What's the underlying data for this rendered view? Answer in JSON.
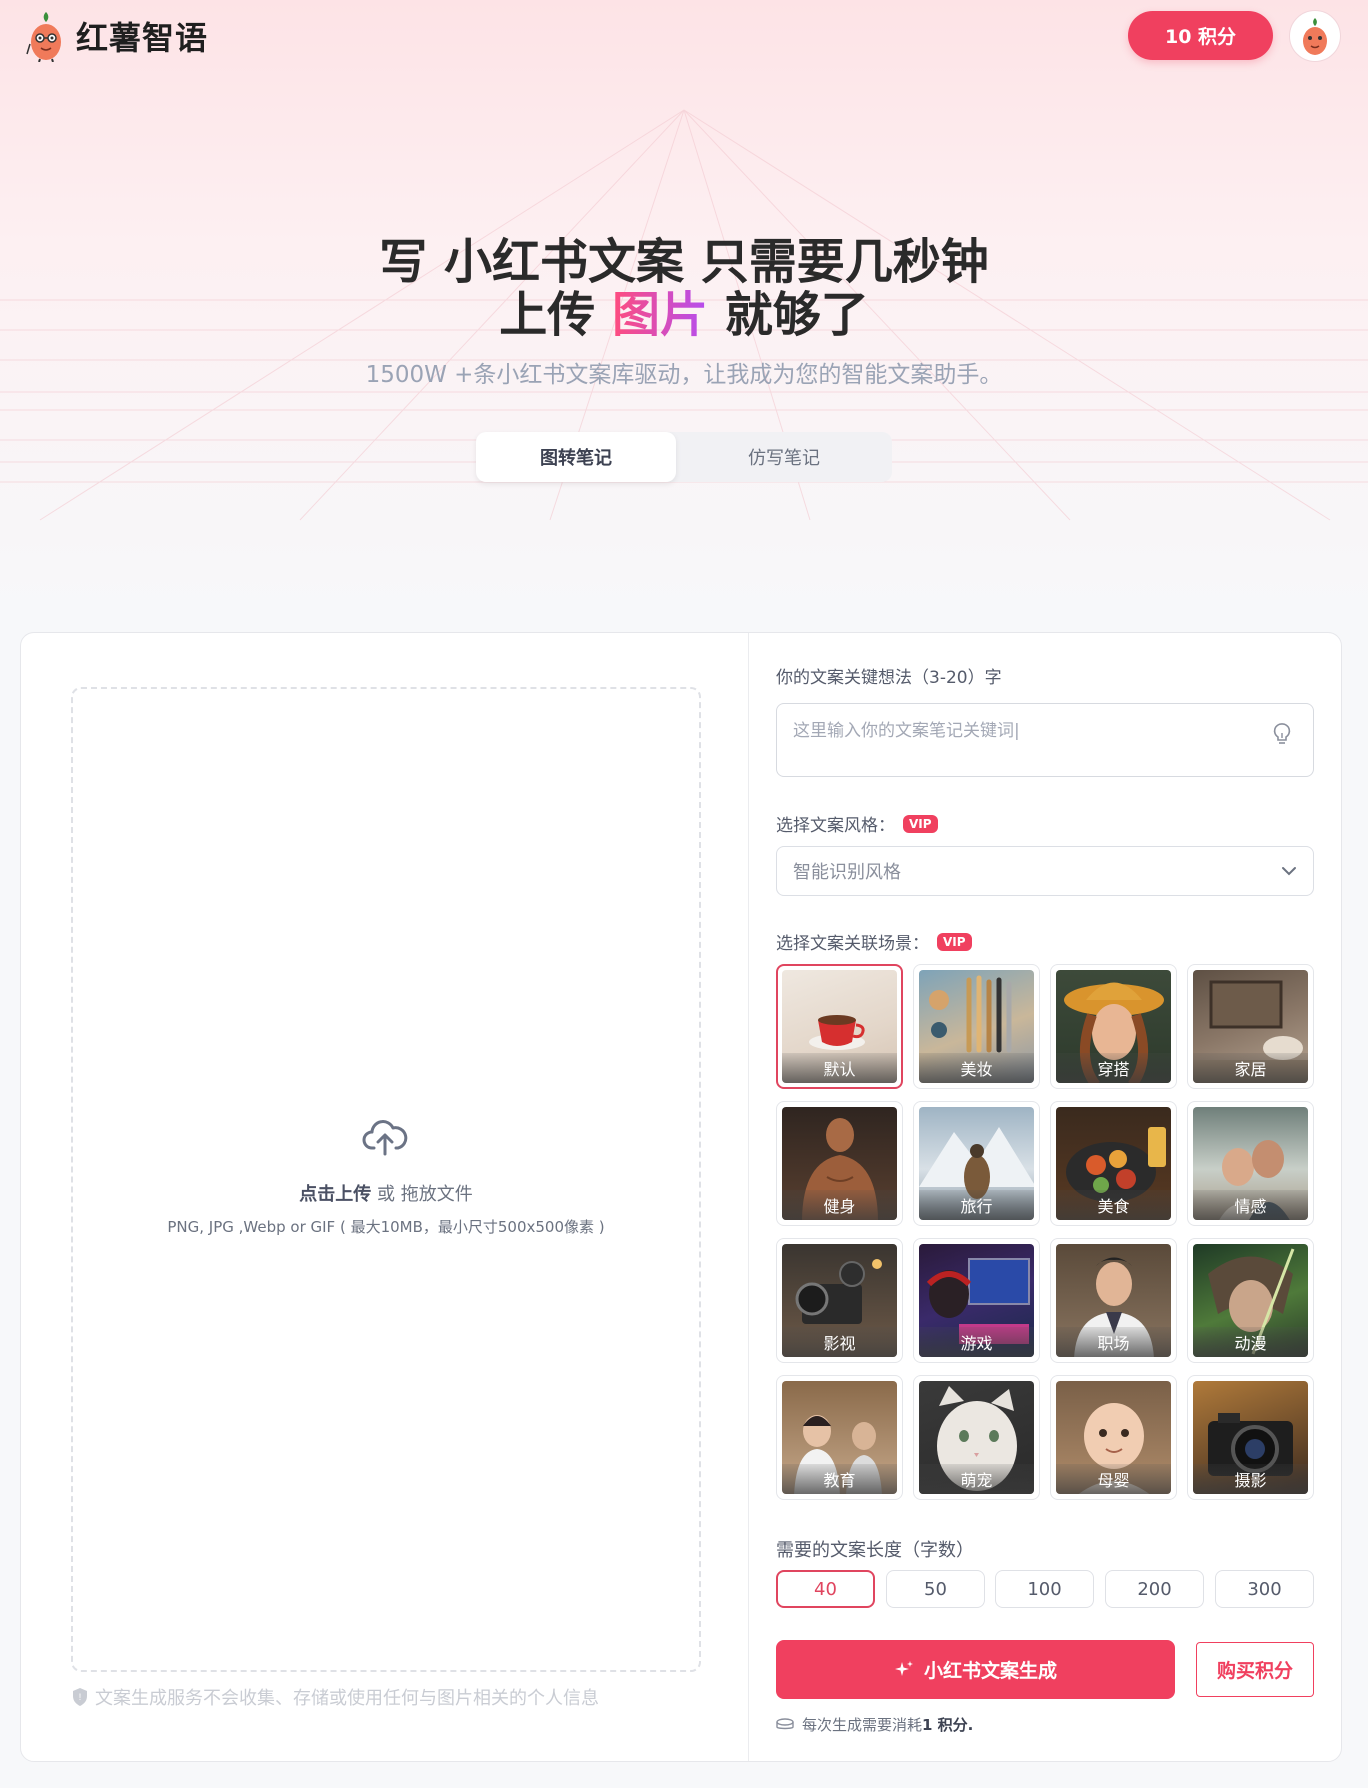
{
  "header": {
    "brand": "红薯智语",
    "points_label": "10 积分"
  },
  "hero": {
    "title_line1": "写 小红书文案 只需要几秒钟",
    "title_line2_pre": "上传 ",
    "title_line2_highlight": "图片",
    "title_line2_post": " 就够了",
    "subtitle": "1500W +条小红书文案库驱动，让我成为您的智能文案助手。"
  },
  "tabs": [
    {
      "label": "图转笔记",
      "active": true
    },
    {
      "label": "仿写笔记",
      "active": false
    }
  ],
  "upload": {
    "action": "点击上传",
    "or_drag": " 或 拖放文件",
    "hint": "PNG, JPG ,Webp or GIF ( 最大10MB，最小尺寸500x500像素 )",
    "privacy": "文案生成服务不会收集、存储或使用任何与图片相关的个人信息"
  },
  "form": {
    "keyword_label": "你的文案关键想法（3-20）字",
    "keyword_placeholder": "这里输入你的文案笔记关键词|",
    "style_label": "选择文案风格：",
    "style_value": "智能识别风格",
    "scene_label": "选择文案关联场景：",
    "vip_badge": "VIP",
    "scenes": [
      {
        "label": "默认",
        "icon": "coffee-cup",
        "selected": true
      },
      {
        "label": "美妆",
        "icon": "makeup-brushes",
        "selected": false
      },
      {
        "label": "穿搭",
        "icon": "hat-woman",
        "selected": false
      },
      {
        "label": "家居",
        "icon": "living-room",
        "selected": false
      },
      {
        "label": "健身",
        "icon": "athlete",
        "selected": false
      },
      {
        "label": "旅行",
        "icon": "mountain-traveler",
        "selected": false
      },
      {
        "label": "美食",
        "icon": "food-bowl",
        "selected": false
      },
      {
        "label": "情感",
        "icon": "couple",
        "selected": false
      },
      {
        "label": "影视",
        "icon": "film-camera",
        "selected": false
      },
      {
        "label": "游戏",
        "icon": "gamer",
        "selected": false
      },
      {
        "label": "职场",
        "icon": "businessman",
        "selected": false
      },
      {
        "label": "动漫",
        "icon": "anime-character",
        "selected": false
      },
      {
        "label": "教育",
        "icon": "classroom",
        "selected": false
      },
      {
        "label": "萌宠",
        "icon": "white-cat",
        "selected": false
      },
      {
        "label": "母婴",
        "icon": "baby",
        "selected": false
      },
      {
        "label": "摄影",
        "icon": "photo-camera",
        "selected": false
      }
    ],
    "length_label": "需要的文案长度（字数）",
    "lengths": [
      "40",
      "50",
      "100",
      "200",
      "300"
    ],
    "selected_length": "40",
    "generate_label": "小红书文案生成",
    "buy_label": "购买积分",
    "cost_prefix": "每次生成需要消耗",
    "cost_value": "1 积分."
  },
  "colors": {
    "accent": "#f0405f",
    "accent_dark": "#e0455f"
  }
}
